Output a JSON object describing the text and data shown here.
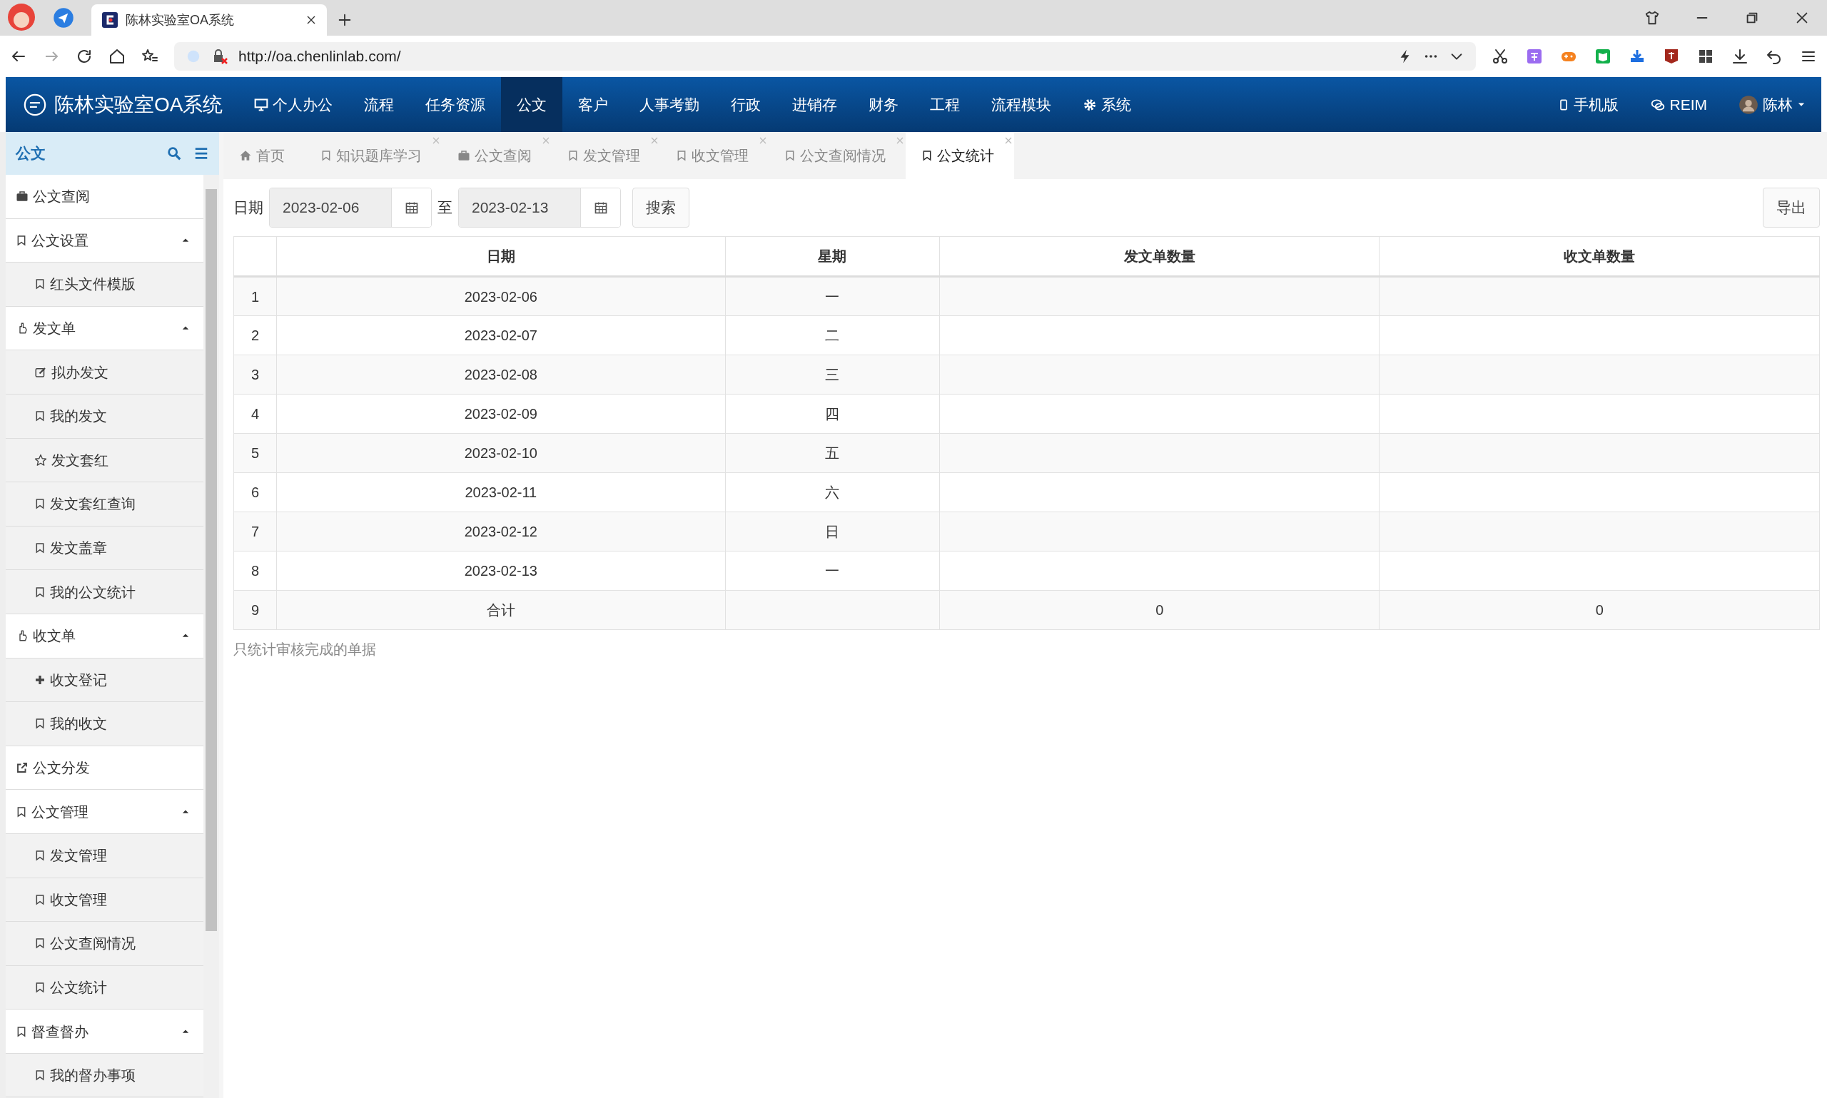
{
  "browser": {
    "tab_title": "陈林实验室OA系统",
    "url": "http://oa.chenlinlab.com/"
  },
  "navbar": {
    "brand": "陈林实验室OA系统",
    "items": [
      {
        "label": "个人办公",
        "selected": false
      },
      {
        "label": "流程",
        "selected": false
      },
      {
        "label": "任务资源",
        "selected": false
      },
      {
        "label": "公文",
        "selected": true
      },
      {
        "label": "客户",
        "selected": false
      },
      {
        "label": "人事考勤",
        "selected": false
      },
      {
        "label": "行政",
        "selected": false
      },
      {
        "label": "进销存",
        "selected": false
      },
      {
        "label": "财务",
        "selected": false
      },
      {
        "label": "工程",
        "selected": false
      },
      {
        "label": "流程模块",
        "selected": false
      },
      {
        "label": "系统",
        "selected": false
      }
    ],
    "right_items": [
      {
        "label": "手机版"
      },
      {
        "label": "REIM"
      },
      {
        "label": "陈林"
      }
    ]
  },
  "sidebar": {
    "title": "公文",
    "items": [
      {
        "label": "公文查阅"
      },
      {
        "label": "公文设置",
        "expanded": true,
        "children": [
          {
            "label": "红头文件模版"
          }
        ]
      },
      {
        "label": "发文单",
        "expanded": true,
        "children": [
          {
            "label": "拟办发文"
          },
          {
            "label": "我的发文"
          },
          {
            "label": "发文套红"
          },
          {
            "label": "发文套红查询"
          },
          {
            "label": "发文盖章"
          },
          {
            "label": "我的公文统计"
          }
        ]
      },
      {
        "label": "收文单",
        "expanded": true,
        "children": [
          {
            "label": "收文登记"
          },
          {
            "label": "我的收文"
          }
        ]
      },
      {
        "label": "公文分发"
      },
      {
        "label": "公文管理",
        "expanded": true,
        "children": [
          {
            "label": "发文管理"
          },
          {
            "label": "收文管理"
          },
          {
            "label": "公文查阅情况"
          },
          {
            "label": "公文统计"
          }
        ]
      },
      {
        "label": "督查督办",
        "expanded": true,
        "children": [
          {
            "label": "我的督办事项"
          }
        ]
      }
    ]
  },
  "tabs": [
    {
      "label": "首页",
      "closable": false,
      "selected": false
    },
    {
      "label": "知识题库学习",
      "closable": true,
      "selected": false
    },
    {
      "label": "公文查阅",
      "closable": true,
      "selected": false
    },
    {
      "label": "发文管理",
      "closable": true,
      "selected": false
    },
    {
      "label": "收文管理",
      "closable": true,
      "selected": false
    },
    {
      "label": "公文查阅情况",
      "closable": true,
      "selected": false
    },
    {
      "label": "公文统计",
      "closable": true,
      "selected": true
    }
  ],
  "filter": {
    "label": "日期",
    "start_date": "2023-02-06",
    "separator": "至",
    "end_date": "2023-02-13",
    "search_button": "搜索",
    "export_button": "导出"
  },
  "table": {
    "columns": [
      "日期",
      "星期",
      "发文单数量",
      "收文单数量"
    ],
    "rows": [
      {
        "index": "1",
        "date": "2023-02-06",
        "weekday": "一"
      },
      {
        "index": "2",
        "date": "2023-02-07",
        "weekday": "二"
      },
      {
        "index": "3",
        "date": "2023-02-08",
        "weekday": "三"
      },
      {
        "index": "4",
        "date": "2023-02-09",
        "weekday": "四"
      },
      {
        "index": "5",
        "date": "2023-02-10",
        "weekday": "五"
      },
      {
        "index": "6",
        "date": "2023-02-11",
        "weekday": "六"
      },
      {
        "index": "7",
        "date": "2023-02-12",
        "weekday": "日"
      },
      {
        "index": "8",
        "date": "2023-02-13",
        "weekday": "一"
      },
      {
        "index": "9",
        "date": "合计",
        "sent": "0",
        "received": "0"
      }
    ]
  },
  "note": "只统计审核完成的单据"
}
